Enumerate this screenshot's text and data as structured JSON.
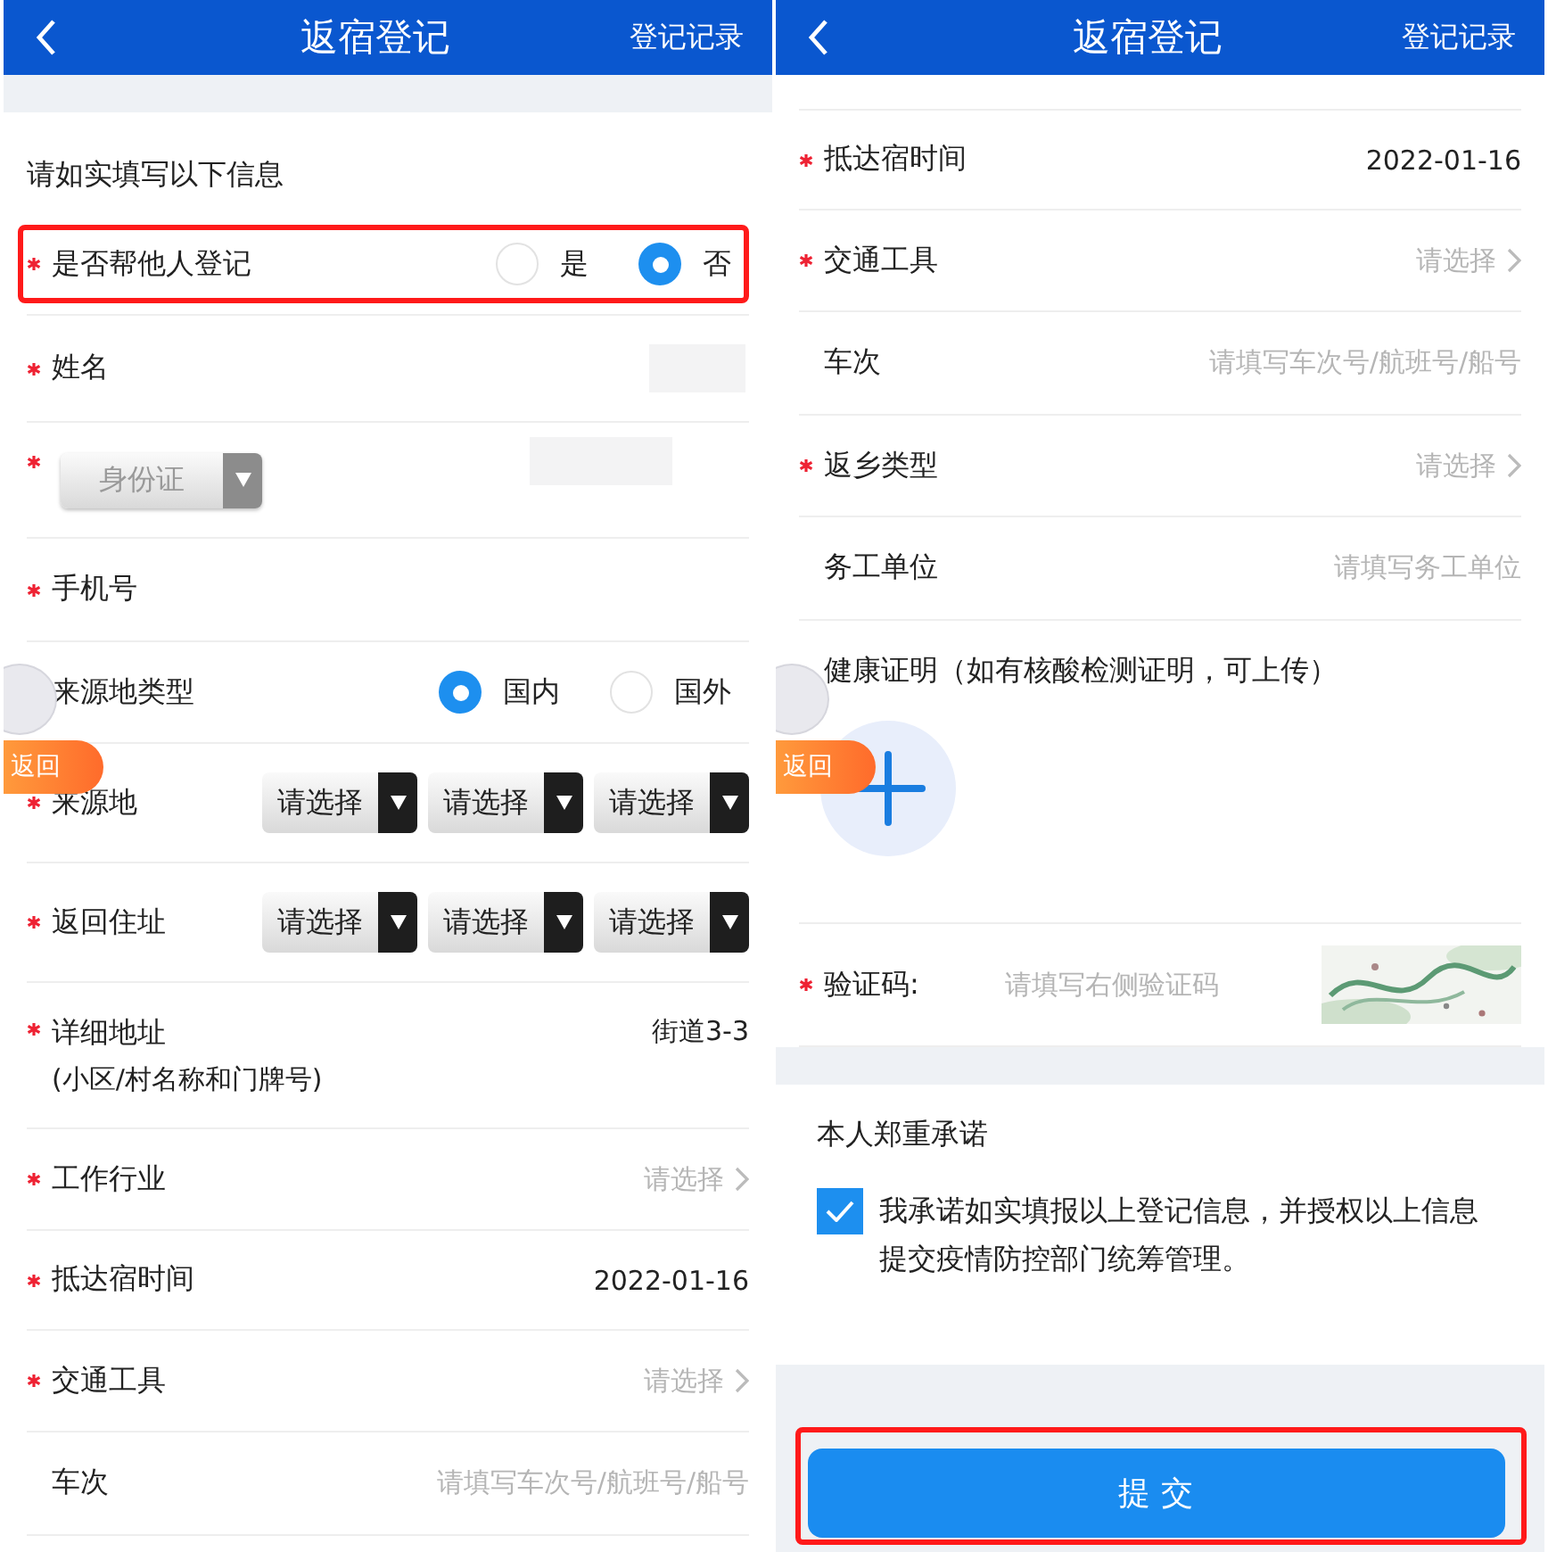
{
  "screens": [
    {
      "header": {
        "title": "返宿登记",
        "action": "登记记录"
      },
      "intro": "请如实填写以下信息",
      "floating_back": "返回",
      "rows": [
        {
          "kind": "radio",
          "label": "是否帮他人登记",
          "required": true,
          "highlighted": true,
          "options": [
            {
              "label": "是",
              "selected": false
            },
            {
              "label": "否",
              "selected": true
            }
          ]
        },
        {
          "kind": "redacted",
          "label": "姓名",
          "required": true
        },
        {
          "kind": "id_select",
          "required": true,
          "select": "身份证"
        },
        {
          "kind": "input",
          "label": "手机号",
          "required": true
        },
        {
          "kind": "radio",
          "label": "来源地类型",
          "required": false,
          "highlighted": false,
          "options": [
            {
              "label": "国内",
              "selected": true
            },
            {
              "label": "国外",
              "selected": false
            }
          ]
        },
        {
          "kind": "selects",
          "label": "来源地",
          "required": true,
          "options": [
            "请选择",
            "请选择",
            "请选择"
          ]
        },
        {
          "kind": "selects",
          "label": "返回住址",
          "required": true,
          "options": [
            "请选择",
            "请选择",
            "请选择"
          ]
        },
        {
          "kind": "address",
          "label": "详细地址",
          "sublabel": "(小区/村名称和门牌号)",
          "required": true,
          "value": "街道3-3"
        },
        {
          "kind": "picker",
          "label": "工作行业",
          "required": true,
          "placeholder": "请选择"
        },
        {
          "kind": "date",
          "label": "抵达宿时间",
          "required": true,
          "value": "2022-01-16"
        },
        {
          "kind": "picker",
          "label": "交通工具",
          "required": true,
          "placeholder": "请选择"
        },
        {
          "kind": "input",
          "label": "车次",
          "required": false,
          "placeholder": "请填写车次号/航班号/船号"
        }
      ]
    },
    {
      "header": {
        "title": "返宿登记",
        "action": "登记记录"
      },
      "floating_back": "返回",
      "rows": [
        {
          "kind": "date",
          "label": "抵达宿时间",
          "required": true,
          "value": "2022-01-16"
        },
        {
          "kind": "picker",
          "label": "交通工具",
          "required": true,
          "placeholder": "请选择"
        },
        {
          "kind": "input",
          "label": "车次",
          "required": false,
          "placeholder": "请填写车次号/航班号/船号"
        },
        {
          "kind": "picker",
          "label": "返乡类型",
          "required": true,
          "placeholder": "请选择"
        },
        {
          "kind": "input",
          "label": "务工单位",
          "required": false,
          "placeholder": "请填写务工单位"
        },
        {
          "kind": "upload",
          "label": "健康证明（如有核酸检测证明，可上传）",
          "required": false
        },
        {
          "kind": "captcha",
          "label": "验证码:",
          "required": true,
          "placeholder": "请填写右侧验证码"
        }
      ],
      "pledge": {
        "title": "本人郑重承诺",
        "checked": true,
        "text": "我承诺如实填报以上登记信息，并授权以上信息提交疫情防控部门统筹管理。"
      },
      "submit": {
        "label": "提 交",
        "highlighted": true
      }
    }
  ]
}
